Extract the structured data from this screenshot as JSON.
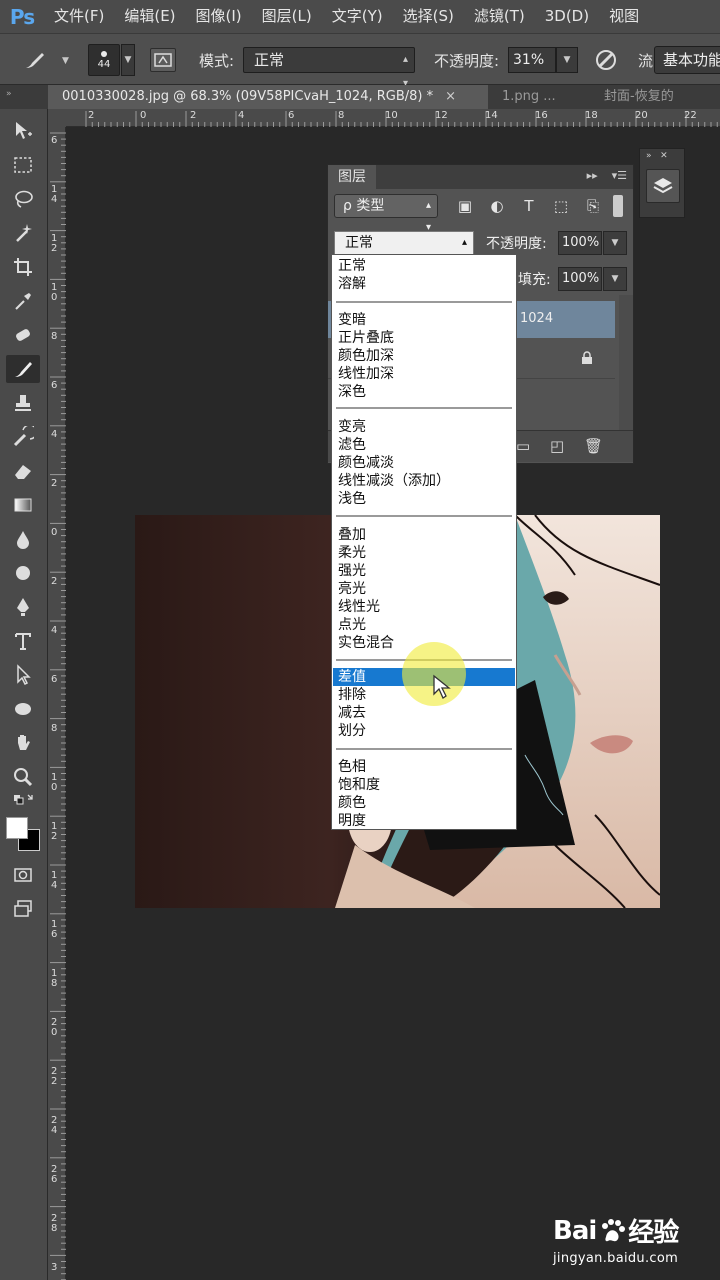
{
  "app": {
    "logo": "Ps"
  },
  "menu": [
    "文件(F)",
    "编辑(E)",
    "图像(I)",
    "图层(L)",
    "文字(Y)",
    "选择(S)",
    "滤镜(T)",
    "3D(D)",
    "视图"
  ],
  "options_bar": {
    "brush_size": "44",
    "mode_label": "模式:",
    "mode_value": "正常",
    "opacity_label": "不透明度:",
    "opacity_value": "31%",
    "truncated_label": "流",
    "workspace": "基本功能"
  },
  "tabs": [
    {
      "label": "0010330028.jpg @ 68.3% (09V58PICvaH_1024, RGB/8) *",
      "close": "×",
      "active": true
    },
    {
      "label": "1.png ...",
      "close": "",
      "active": false
    },
    {
      "label": "封面-恢复的",
      "close": "",
      "active": false
    }
  ],
  "ruler_h_labels": [
    "2",
    "0",
    "2",
    "4",
    "6",
    "8",
    "10",
    "12",
    "14",
    "16",
    "18",
    "20",
    "22"
  ],
  "ruler_v_labels": [
    "6",
    "1\n4",
    "1\n2",
    "1\n0",
    "8",
    "6",
    "4",
    "2",
    "0",
    "2",
    "4",
    "6",
    "8",
    "1\n0",
    "1\n2",
    "1\n4",
    "1\n6",
    "1\n8",
    "2\n0",
    "2\n2",
    "2\n4",
    "2\n6",
    "2\n8",
    "3"
  ],
  "layers_panel": {
    "title": "图层",
    "filter": "ρ 类型",
    "blend_mode": "正常",
    "opacity_label": "不透明度:",
    "opacity_value": "100%",
    "fill_label": "填充:",
    "fill_value": "100%",
    "layer1_name": "1024"
  },
  "blend_modes": {
    "groups": [
      [
        "正常",
        "溶解"
      ],
      [
        "变暗",
        "正片叠底",
        "颜色加深",
        "线性加深",
        "深色"
      ],
      [
        "变亮",
        "滤色",
        "颜色减淡",
        "线性减淡（添加）",
        "浅色"
      ],
      [
        "叠加",
        "柔光",
        "强光",
        "亮光",
        "线性光",
        "点光",
        "实色混合"
      ],
      [
        "差值",
        "排除",
        "减去",
        "划分"
      ],
      [
        "色相",
        "饱和度",
        "颜色",
        "明度"
      ]
    ],
    "selected": "差值"
  },
  "watermark": {
    "brand_left": "Bai",
    "brand_right": "经验",
    "url": "jingyan.baidu.com"
  },
  "colors": {
    "selection": "#1779d0",
    "ps_blue": "#5aa7ee",
    "photo_bg": "#6da7a8"
  }
}
